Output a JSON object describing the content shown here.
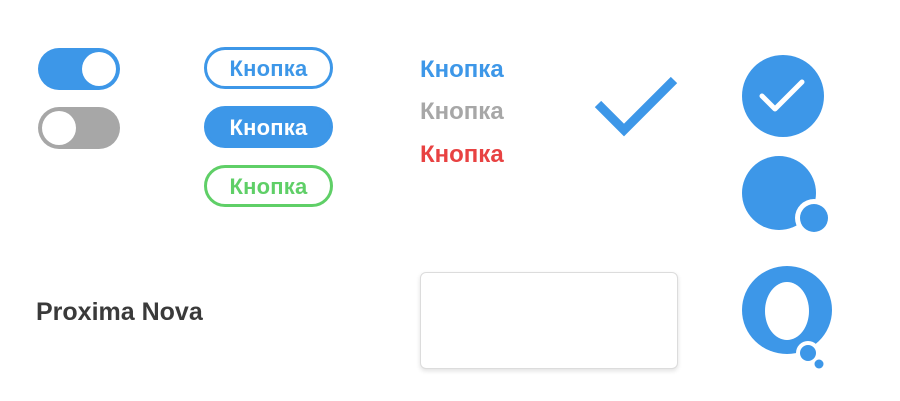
{
  "toggles": [
    {
      "state": "on"
    },
    {
      "state": "off"
    }
  ],
  "buttons": {
    "outline_blue_label": "Кнопка",
    "solid_blue_label": "Кнопка",
    "outline_green_label": "Кнопка"
  },
  "links": {
    "blue_label": "Кнопка",
    "gray_label": "Кнопка",
    "red_label": "Кнопка"
  },
  "font_label": "Proxima Nova",
  "input": {
    "value": "",
    "placeholder": ""
  },
  "icons": [
    "check-icon",
    "check-circle-icon",
    "chat-bubble-icon",
    "chat-bubble-outline-icon"
  ],
  "colors": {
    "accent_blue": "#3d97e8",
    "inactive_gray": "#a7a7a7",
    "success_green": "#5fcf67",
    "danger_red": "#e84242",
    "text_dark": "#3a3a3a"
  }
}
